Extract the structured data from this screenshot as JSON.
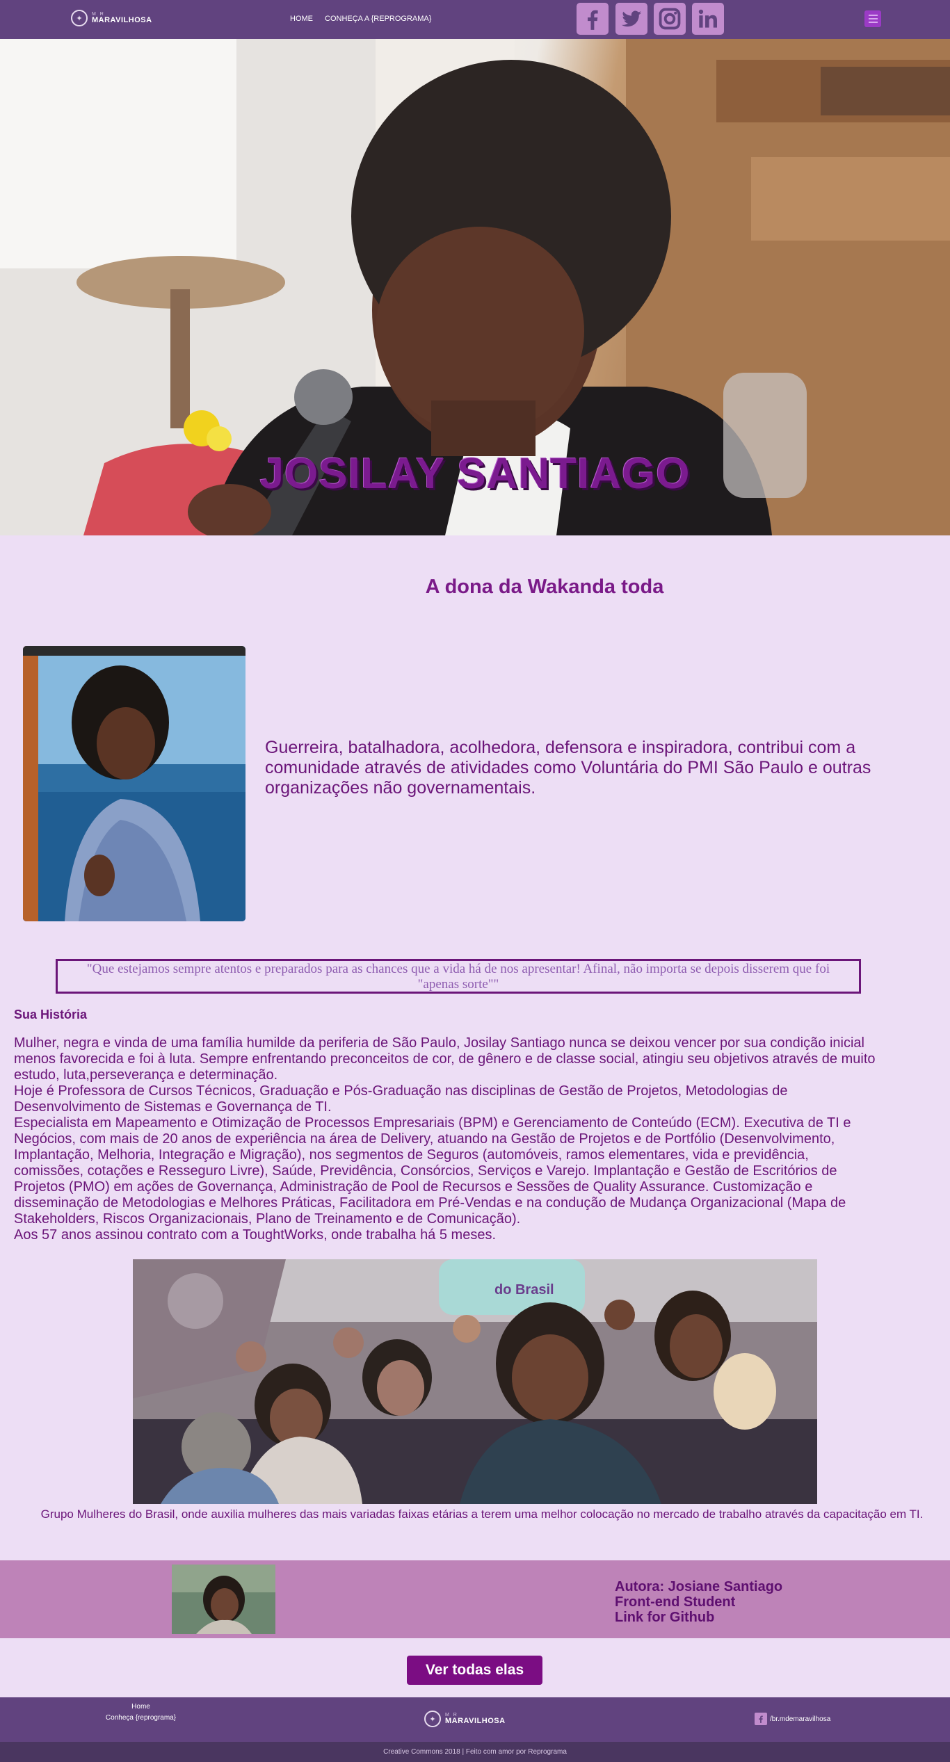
{
  "nav": {
    "logo_small": "M R",
    "logo_big": "MARAVILHOSA",
    "home_label": "HOME",
    "conheca_label": "CONHEÇA A {REPROGRAMA}",
    "social": [
      "facebook-icon",
      "twitter-icon",
      "instagram-icon",
      "linkedin-icon"
    ],
    "menu_icon": "hamburger-menu-icon"
  },
  "hero": {
    "name": "JOSILAY SANTIAGO"
  },
  "main": {
    "tagline": "A dona da Wakanda toda",
    "intro": "Guerreira, batalhadora, acolhedora, defensora e inspiradora, contribui com a comunidade através de atividades como Voluntária do PMI São Paulo e outras organizações não governamentais.",
    "quote": "\"Que estejamos sempre atentos e preparados para as chances que a vida há de nos apresentar! Afinal, não importa se depois disserem que foi \"apenas sorte\"\"",
    "story_title": "Sua História",
    "story": [
      "Mulher, negra e vinda de uma família humilde da periferia de São Paulo, Josilay Santiago nunca se deixou vencer por sua condição inicial menos favorecida e foi à luta. Sempre enfrentando preconceitos de cor, de gênero e de classe social, atingiu seu objetivos através de muito estudo, luta,perseverança e determinação.",
      "Hoje é Professora de Cursos Técnicos, Graduação e Pós-Graduação nas disciplinas de Gestão de Projetos, Metodologias de Desenvolvimento de Sistemas e Governança de TI.",
      "Especialista em Mapeamento e Otimização de Processos Empresariais (BPM) e Gerenciamento de Conteúdo (ECM). Executiva de TI e Negócios, com mais de 20 anos de experiência na área de Delivery, atuando na Gestão de Projetos e de Portfólio (Desenvolvimento, Implantação, Melhoria, Integração e Migração), nos segmentos de Seguros (automóveis, ramos elementares, vida e previdência, comissões, cotações e Resseguro Livre), Saúde, Previdência, Consórcios, Serviços e Varejo. Implantação e Gestão de Escritórios de Projetos (PMO) em ações de Governança, Administração de Pool de Recursos e Sessões de Quality Assurance. Customização e disseminação de Metodologias e Melhores Práticas, Facilitadora em Pré-Vendas e na condução de Mudança Organizacional (Mapa de Stakeholders, Riscos Organizacionais, Plano de Treinamento e de Comunicação).",
      "Aos 57 anos assinou contrato com a ToughtWorks, onde trabalha há 5 meses."
    ],
    "group_caption": "Grupo Mulheres do Brasil, onde auxilia mulheres das mais variadas faixas etárias a terem uma melhor colocação no mercado de trabalho através da capacitação em TI.",
    "banner_text": "do Brasil"
  },
  "author": {
    "name": "Autora: Josiane Santiago",
    "role": "Front-end Student",
    "github": "Link for Github"
  },
  "cta_label": "Ver todas elas",
  "footer": {
    "home": "Home",
    "conheca": "Conheça {reprograma}",
    "logo_small": "M R",
    "logo_big": "MARAVILHOSA",
    "facebook": "/br.mdemaravilhosa",
    "copyright": "Creative Commons 2018 | Feito com amor por Reprograma"
  },
  "colors": {
    "nav_bg": "#61437f",
    "page_bg": "#eddef5",
    "accent": "#7b0d83",
    "text": "#6b1579",
    "author_bg": "#be83b8"
  }
}
